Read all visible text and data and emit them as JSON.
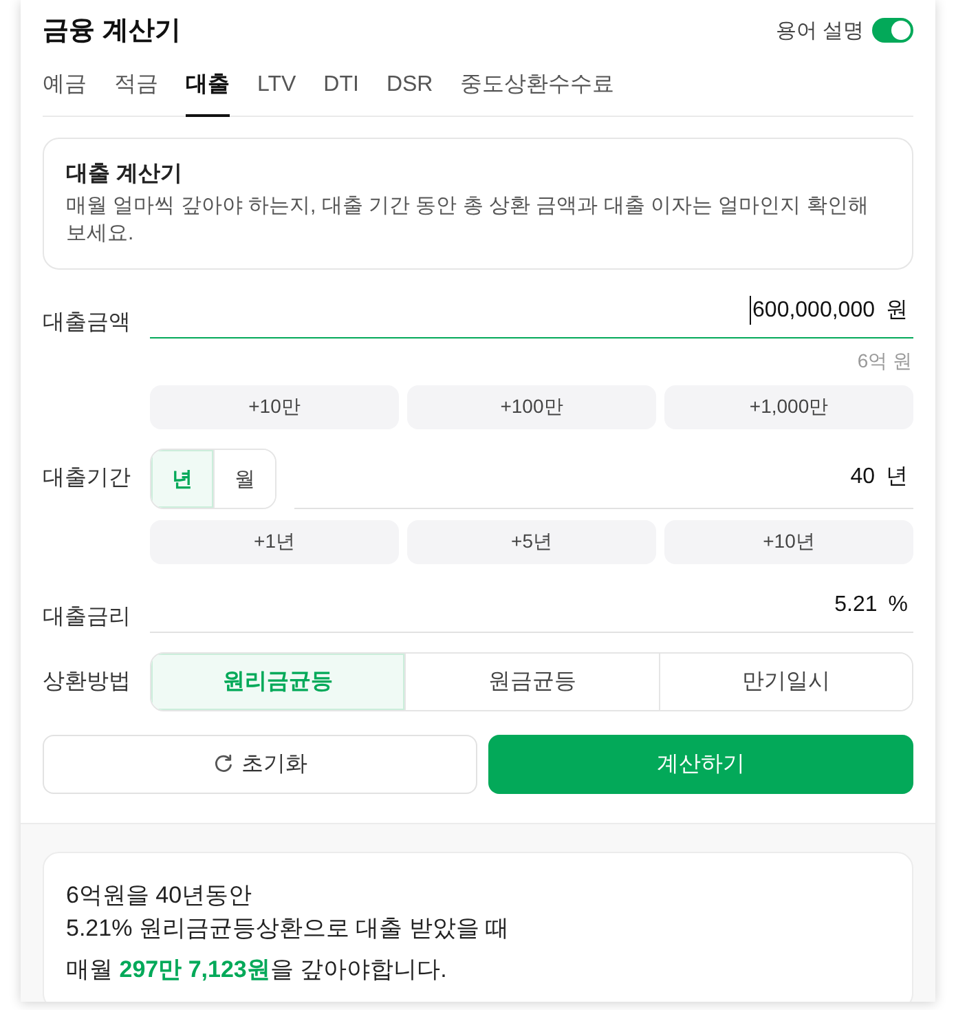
{
  "header": {
    "title": "금융 계산기",
    "glossary_toggle": {
      "label": "용어 설명",
      "on": true
    }
  },
  "tabs": [
    {
      "label": "예금",
      "selected": false
    },
    {
      "label": "적금",
      "selected": false
    },
    {
      "label": "대출",
      "selected": true
    },
    {
      "label": "LTV",
      "selected": false
    },
    {
      "label": "DTI",
      "selected": false
    },
    {
      "label": "DSR",
      "selected": false
    },
    {
      "label": "중도상환수수료",
      "selected": false
    }
  ],
  "intro": {
    "title": "대출 계산기",
    "description": "매월 얼마씩 갚아야 하는지, 대출 기간 동안 총 상환 금액과 대출 이자는 얼마인지 확인해 보세요."
  },
  "loan_form": [
    {
      "kind": "field",
      "label": "대출금액",
      "field": {
        "value": "600,000,000",
        "unit": "원",
        "focused": true
      },
      "helper": "6억 원",
      "quick_buttons": [
        "+10만",
        "+100만",
        "+1,000만"
      ]
    },
    {
      "kind": "field",
      "label": "대출기간",
      "unit_options": [
        {
          "label": "년",
          "selected": true
        },
        {
          "label": "월",
          "selected": false
        }
      ],
      "field": {
        "value": "40",
        "unit": "년",
        "focused": false
      },
      "quick_buttons": [
        "+1년",
        "+5년",
        "+10년"
      ]
    },
    {
      "kind": "field",
      "label": "대출금리",
      "field": {
        "value": "5.21",
        "unit": "%",
        "focused": false
      }
    },
    {
      "kind": "choice",
      "label": "상환방법",
      "options": [
        {
          "label": "원리금균등",
          "selected": true
        },
        {
          "label": "원금균등",
          "selected": false
        },
        {
          "label": "만기일시",
          "selected": false
        }
      ]
    }
  ],
  "actions": {
    "reset": "초기화",
    "calculate": "계산하기"
  },
  "result": {
    "lines": [
      "6억원을 40년동안",
      "5.21% 원리금균등상환으로 대출 받았을 때"
    ],
    "summary": "매월 **297만 7,123원**을 갚아야합니다."
  }
}
